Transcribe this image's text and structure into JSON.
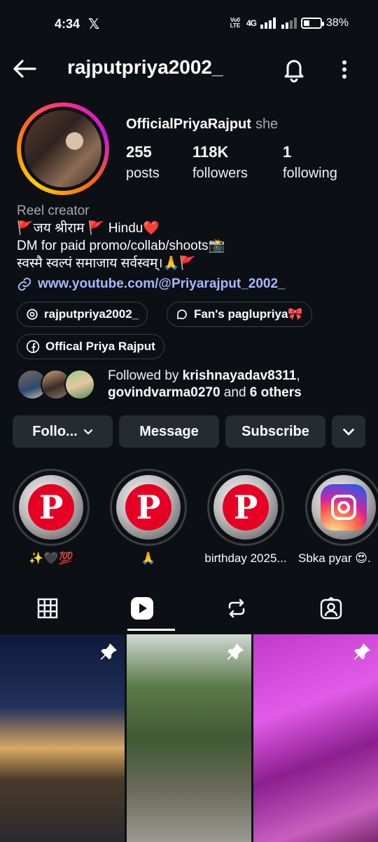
{
  "status": {
    "time": "4:34",
    "x_icon": "x-logo-icon",
    "volte": "Vo0 LTE",
    "network": "4G",
    "battery": "38%",
    "battery_level": 0.38
  },
  "header": {
    "username": "rajputpriya2002_"
  },
  "profile": {
    "display_name": "OfficialPriyaRajput",
    "pronoun": "she",
    "stats": [
      {
        "num": "255",
        "label": "posts"
      },
      {
        "num": "118K",
        "label": "followers"
      },
      {
        "num": "1",
        "label": "following"
      }
    ],
    "category": "Reel creator",
    "bio_lines": [
      "🚩जय श्रीराम 🚩 Hindu❤️",
      "DM for paid promo/collab/shoots📸",
      "स्वस्मै स्वल्पं समाजाय सर्वस्वम्।🙏🚩"
    ],
    "link": "www.youtube.com/@Priyarajput_2002_"
  },
  "chips": [
    {
      "label": "rajputpriya2002_",
      "icon": "threads-icon"
    },
    {
      "label": "Fan's paglupriya🎀",
      "icon": "chat-bubble-icon"
    },
    {
      "label": "Offical Priya Rajput",
      "icon": "facebook-icon"
    }
  ],
  "followed_by": {
    "prefix": "Followed by ",
    "user1": "krishnayadav8311",
    "comma": ",",
    "user2": "govindvarma0270",
    "and": " and ",
    "others": "6 others"
  },
  "actions": {
    "follow": "Follo...",
    "message": "Message",
    "subscribe": "Subscribe"
  },
  "highlights": [
    {
      "label": "✨🖤💯",
      "icon": "pinterest-icon"
    },
    {
      "label": "🙏",
      "icon": "pinterest-icon"
    },
    {
      "label": "birthday 2025...",
      "icon": "pinterest-icon"
    },
    {
      "label": "Sbka pyar 😍...",
      "icon": "instagram-icon"
    }
  ],
  "tabs": [
    "grid-icon",
    "reels-icon",
    "reposts-icon",
    "tagged-icon"
  ],
  "active_tab": 1,
  "colors": {
    "background": "#0c0f14",
    "button": "#262a31",
    "link": "#a6b8ff",
    "muted": "#a8a8a8",
    "pinterest": "#e60023"
  }
}
